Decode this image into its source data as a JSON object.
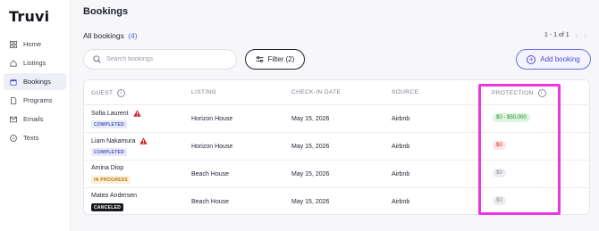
{
  "app": {
    "logo": "Truvi"
  },
  "sidebar": {
    "items": [
      {
        "label": "Home",
        "icon": "grid-icon",
        "active": false
      },
      {
        "label": "Listings",
        "icon": "house-icon",
        "active": false
      },
      {
        "label": "Bookings",
        "icon": "calendar-icon",
        "active": true
      },
      {
        "label": "Programs",
        "icon": "document-icon",
        "active": false
      },
      {
        "label": "Emails",
        "icon": "mail-icon",
        "active": false
      },
      {
        "label": "Texts",
        "icon": "chat-icon",
        "active": false
      }
    ]
  },
  "header": {
    "title": "Bookings",
    "section_title": "All bookings",
    "count": "(4)",
    "pagination": "1 - 1 of 1"
  },
  "toolbar": {
    "search_placeholder": "Search bookings",
    "search_value": "",
    "filter_label": "Filter (2)",
    "add_label": "Add booking"
  },
  "table": {
    "columns": {
      "guest": "GUEST",
      "listing": "LISTING",
      "checkin": "CHECK-IN DATE",
      "source": "SOURCE",
      "protection": "PROTECTION"
    },
    "rows": [
      {
        "guest": "Sofia Laurent",
        "warning": true,
        "status": "COMPLETED",
        "listing": "Horizon House",
        "checkin": "May 15, 2026",
        "source": "Airbnb",
        "protection": "$0 - $50,000"
      },
      {
        "guest": "Liam Nakamura",
        "warning": true,
        "status": "COMPLETED",
        "listing": "Horizon House",
        "checkin": "May 15, 2026",
        "source": "Airbnb",
        "protection": "$0"
      },
      {
        "guest": "Amina Diop",
        "warning": false,
        "status": "IN PROGRESS",
        "listing": "Beach House",
        "checkin": "May 15, 2026",
        "source": "Airbnb",
        "protection": "$0"
      },
      {
        "guest": "Mateo Andersen",
        "warning": false,
        "status": "CANCELED",
        "listing": "Beach House",
        "checkin": "May 15, 2026",
        "source": "Airbnb",
        "protection": "$0"
      }
    ]
  },
  "colors": {
    "accent": "#5b5fd9",
    "highlight": "#ec36e0",
    "warning": "#d4232f"
  }
}
